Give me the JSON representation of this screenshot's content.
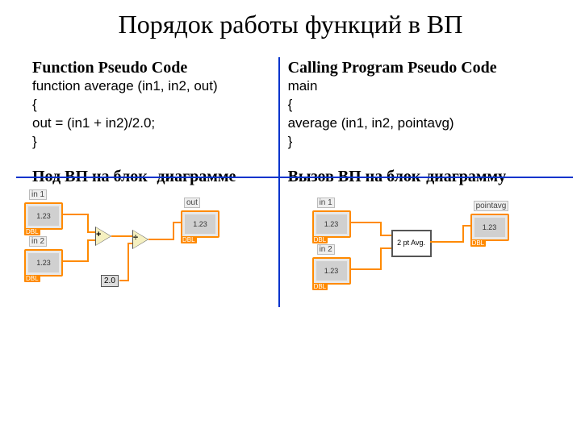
{
  "title": "Порядок работы функций в ВП",
  "quads": {
    "tl": {
      "heading": "Function Pseudo Code",
      "lines": [
        "function average (in1, in2, out)",
        "{",
        "out = (in1 + in2)/2.0;",
        "}"
      ]
    },
    "tr": {
      "heading": "Calling Program Pseudo Code",
      "lines": [
        "main",
        "{",
        "average (in1, in2, pointavg)",
        "}"
      ]
    },
    "bl": {
      "heading": "Под ВП на блок- диаграмме"
    },
    "br": {
      "heading": "Вызов  ВП на  блок-диаграмму"
    }
  },
  "diag_left": {
    "in1": "in 1",
    "in2": "in 2",
    "out": "out",
    "const": "2.0",
    "plus": "+",
    "div": "÷",
    "term_text": "1.23",
    "dbl": "DBL"
  },
  "diag_right": {
    "in1": "in 1",
    "in2": "in 2",
    "out": "pointavg",
    "subvi": "2 pt Avg.",
    "term_text": "1.23",
    "dbl": "DBL"
  }
}
